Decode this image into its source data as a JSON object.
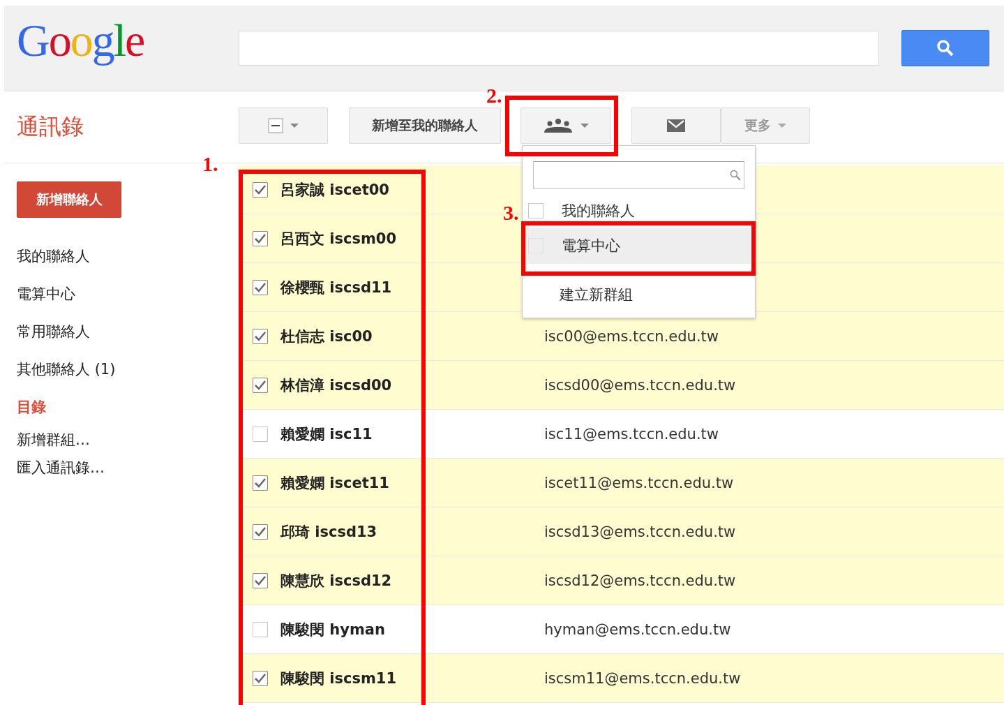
{
  "header": {
    "logo": "Google"
  },
  "sidebar": {
    "title": "通訊錄",
    "new_contact_button": "新增聯絡人",
    "items": [
      {
        "label": "我的聯絡人",
        "kind": "group"
      },
      {
        "label": "電算中心",
        "kind": "group"
      },
      {
        "label": "常用聯絡人",
        "kind": "group"
      },
      {
        "label": "其他聯絡人 (1)",
        "kind": "group"
      },
      {
        "label": "目錄",
        "kind": "heading"
      },
      {
        "label": "新增群組…",
        "kind": "action"
      },
      {
        "label": "匯入通訊錄…",
        "kind": "action"
      }
    ]
  },
  "toolbar": {
    "add_to_contacts": "新增至我的聯絡人",
    "more": "更多"
  },
  "group_menu": {
    "items": [
      {
        "label": "我的聯絡人",
        "kind": "checkbox",
        "checked": false,
        "selected": false
      },
      {
        "label": "電算中心",
        "kind": "checkbox",
        "checked": false,
        "selected": true
      },
      {
        "label": "建立新群組",
        "kind": "action",
        "selected": false
      }
    ]
  },
  "contacts": [
    {
      "name": "呂家誠 iscet00",
      "checked": true
    },
    {
      "name": "呂西文 iscsm00",
      "checked": true
    },
    {
      "name": "徐櫻甄 iscsd11",
      "checked": true
    },
    {
      "name": "杜信志 isc00",
      "email": "isc00@ems.tccn.edu.tw",
      "checked": true
    },
    {
      "name": "林信漳 iscsd00",
      "email": "iscsd00@ems.tccn.edu.tw",
      "checked": true
    },
    {
      "name": "賴愛嫻 isc11",
      "email": "isc11@ems.tccn.edu.tw",
      "checked": false
    },
    {
      "name": "賴愛嫻 iscet11",
      "email": "iscet11@ems.tccn.edu.tw",
      "checked": true
    },
    {
      "name": "邱琦 iscsd13",
      "email": "iscsd13@ems.tccn.edu.tw",
      "checked": true
    },
    {
      "name": "陳慧欣 iscsd12",
      "email": "iscsd12@ems.tccn.edu.tw",
      "checked": true
    },
    {
      "name": "陳駿閔 hyman",
      "email": "hyman@ems.tccn.edu.tw",
      "checked": false
    },
    {
      "name": "陳駿閔 iscsm11",
      "email": "iscsm11@ems.tccn.edu.tw",
      "checked": true
    }
  ],
  "annotations": [
    {
      "label": "1."
    },
    {
      "label": "2."
    },
    {
      "label": "3."
    }
  ]
}
